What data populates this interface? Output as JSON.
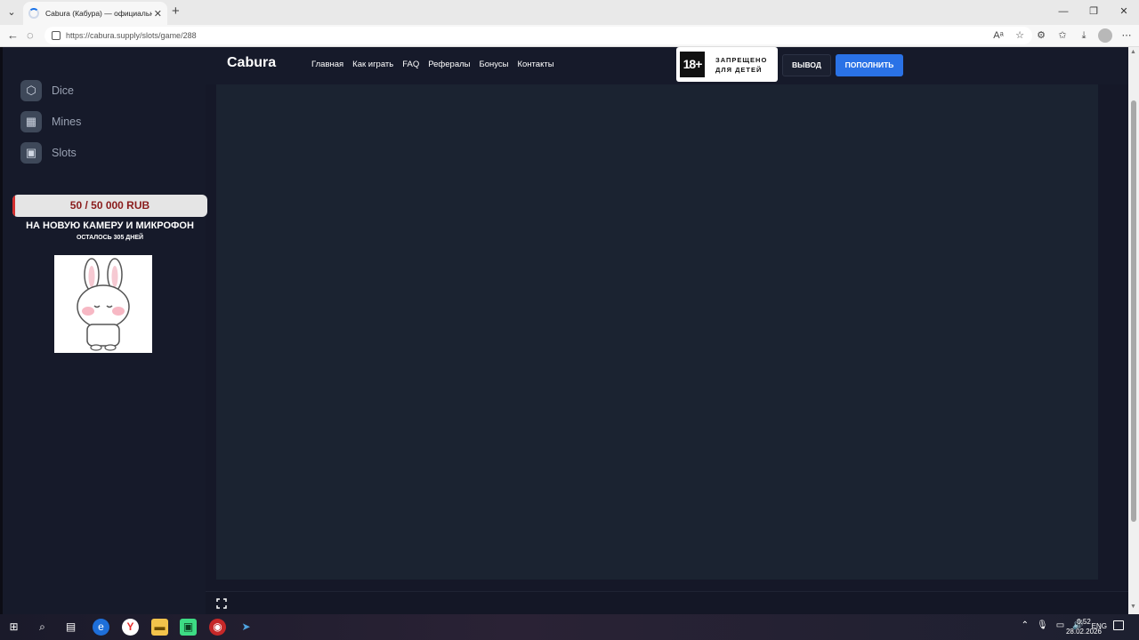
{
  "browser": {
    "tab_title": "Cabura (Кабура) — официальный",
    "url": "https://cabura.supply/slots/game/288",
    "icons": {
      "tab_list": "chevron-down-icon",
      "tab_close": "close-icon",
      "new_tab": "plus-icon",
      "minimize": "minimize-icon",
      "restore": "restore-icon",
      "close": "close-icon",
      "back": "arrow-left-icon",
      "reload": "spinner-icon",
      "read_aloud": "read-aloud-icon",
      "favorite": "star-icon",
      "extensions": "puzzle-icon",
      "collections": "favorites-icon",
      "downloads": "download-icon",
      "profile": "avatar-icon",
      "menu": "ellipsis-icon"
    }
  },
  "sidebar": {
    "items": [
      {
        "label": "Dice",
        "icon": "cube-icon"
      },
      {
        "label": "Mines",
        "icon": "grid-icon"
      },
      {
        "label": "Slots",
        "icon": "slot-machine-icon"
      }
    ]
  },
  "promo": {
    "amount": "50 / 50 000 RUB",
    "progress": 0.001,
    "title": "НА НОВУЮ КАМЕРУ И МИКРОФОН",
    "days_left": "ОСТАЛОСЬ 305 ДНЕЙ",
    "image": "bunny-sticker"
  },
  "header": {
    "logo": "Cabura",
    "nav": [
      "Главная",
      "Как играть",
      "FAQ",
      "Рефералы",
      "Бонусы",
      "Контакты"
    ],
    "age_badge": {
      "number": "18+",
      "line1": "ЗАПРЕЩЕНО",
      "line2": "ДЛЯ ДЕТЕЙ"
    },
    "withdraw_label": "ВЫВОД",
    "deposit_label": "ПОПОЛНИТЬ"
  },
  "game": {
    "fullscreen_icon": "fullscreen-icon"
  },
  "taskbar": {
    "apps": [
      "windows-start-icon",
      "search-icon",
      "task-view-icon",
      "edge-icon",
      "yandex-browser-icon",
      "file-explorer-icon",
      "android-app-icon",
      "chrome-like-icon",
      "steam-icon"
    ],
    "lang": "ENG",
    "time": "0:52",
    "date": "28.02.2026"
  },
  "colors": {
    "page_bg": "#151828",
    "game_bg": "#1b2331",
    "accent_blue": "#2a72e6",
    "promo_red": "#d32f2f"
  }
}
